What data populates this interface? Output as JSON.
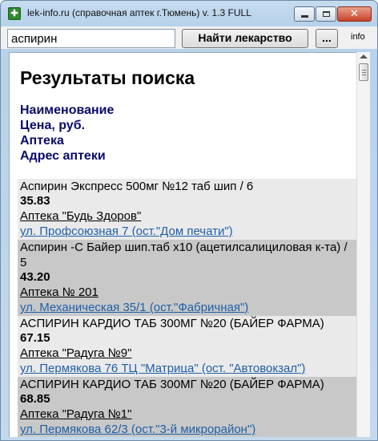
{
  "window": {
    "title": "lek-info.ru (справочная аптек г.Тюмень) v. 1.3 FULL",
    "icon": "app-icon"
  },
  "toolbar": {
    "search_value": "аспирин",
    "find_label": "Найти лекарство",
    "more_label": "...",
    "info_label": "info"
  },
  "content": {
    "heading": "Результаты поиска",
    "legend": [
      "Наименование",
      "Цена, руб.",
      "Аптека",
      "Адрес аптеки"
    ],
    "results": [
      {
        "name": "Аспирин Экспресс 500мг №12 таб шип / 6",
        "price": "35.83",
        "pharmacy": "Аптека \"Будь Здоров\"",
        "address": "ул. Профсоюзная 7 (ост.\"Дом печати\")",
        "shade": "light"
      },
      {
        "name": "Аспирин -С Байер шип.таб х10 (ацетилсалициловая к-та) / 5",
        "price": "43.20",
        "pharmacy": "Аптека № 201",
        "address": "ул. Механическая 35/1 (ост.\"Фабричная\")",
        "shade": "dark"
      },
      {
        "name": "АСПИРИН КАРДИО ТАБ 300МГ №20 (БАЙЕР ФАРМА)",
        "price": "67.15",
        "pharmacy": "Аптека \"Радуга №9\"",
        "address": "ул. Пермякова 76 ТЦ \"Матрица\" (ост. \"Автовокзал\")",
        "shade": "light"
      },
      {
        "name": "АСПИРИН КАРДИО ТАБ 300МГ №20 (БАЙЕР ФАРМА)",
        "price": "68.85",
        "pharmacy": "Аптека \"Радуга №1\"",
        "address": "ул. Пермякова 62/3 (ост.\"3-й микрорайон\")",
        "shade": "dark"
      }
    ]
  },
  "colors": {
    "legend_text": "#0a0a6a",
    "address_link": "#1f5fa8",
    "row_light": "#eaeaea",
    "row_dark": "#c8c8c8"
  }
}
